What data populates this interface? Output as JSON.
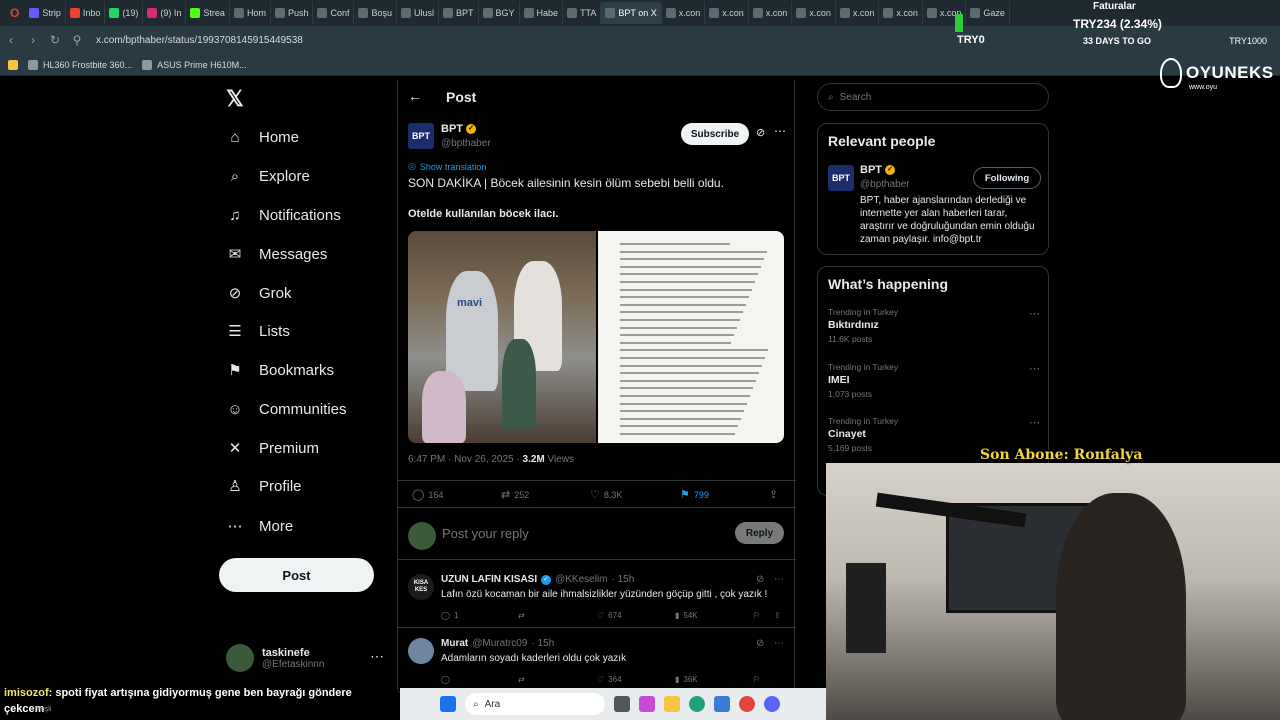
{
  "browser": {
    "tabs": [
      "Strip",
      "Inbo",
      "(19)",
      "(9) In",
      "Strea",
      "Hom",
      "Push",
      "Conf",
      "Boşu",
      "Ulusl",
      "BPT",
      "BGY",
      "Habe",
      "TTA",
      "BPT on X",
      "x.con",
      "x.con",
      "x.con",
      "x.con",
      "x.con",
      "x.con",
      "x.con",
      "Gaze"
    ],
    "url": "x.com/bpthaber/status/1993708145915449538",
    "bookmarks": [
      "HL360 Frostbite 360...",
      "ASUS Prime H610M..."
    ]
  },
  "overlay": {
    "faturalar": "Faturalar",
    "ticker_value": "TRY234 (2.34%)",
    "ticker_currency": "TRY0",
    "days_to_go": "33 DAYS TO GO",
    "ticker_right": "TRY1000",
    "brand_name": "OYUNEKS",
    "brand_sub": "www.oyu",
    "last_sub": "Son Abone: Ronfalya",
    "chat_user": "imisozof",
    "chat_msg": ": spoti fiyat artışına gidiyormuş gene ben bayrağı göndere",
    "chat_msg2": "çekcem",
    "chat_meta": "meşli"
  },
  "nav": {
    "items": [
      {
        "label": "Home",
        "icon": "home-icon"
      },
      {
        "label": "Explore",
        "icon": "search-icon"
      },
      {
        "label": "Notifications",
        "icon": "bell-icon"
      },
      {
        "label": "Messages",
        "icon": "envelope-icon"
      },
      {
        "label": "Grok",
        "icon": "grok-icon"
      },
      {
        "label": "Lists",
        "icon": "list-icon"
      },
      {
        "label": "Bookmarks",
        "icon": "bookmark-icon"
      },
      {
        "label": "Communities",
        "icon": "people-icon"
      },
      {
        "label": "Premium",
        "icon": "x-logo-icon"
      },
      {
        "label": "Profile",
        "icon": "person-icon"
      },
      {
        "label": "More",
        "icon": "more-circle-icon"
      }
    ],
    "post_label": "Post",
    "account_name": "taskinefe",
    "account_handle": "@Efetaskinnn"
  },
  "post": {
    "header": "Post",
    "author_name": "BPT",
    "author_handle": "@bpthaber",
    "logo_text": "BPT",
    "subscribe_label": "Subscribe",
    "show_translation": "Show translation",
    "text_line1": "SON DAKİKA | Böcek ailesinin kesin ölüm sebebi belli oldu.",
    "text_line2": "Otelde kullanılan böcek ilacı.",
    "photo_text": "mavi",
    "time": "6:47 PM · Nov 26, 2025 · ",
    "views": "3.2M",
    "views_label": " Views",
    "stats": {
      "replies": "164",
      "reposts": "252",
      "likes": "8.3K",
      "bookmarks": "799"
    },
    "reply_placeholder": "Post your reply",
    "reply_label": "Reply"
  },
  "replies": [
    {
      "name": "UZUN LAFIN KISASI",
      "handle": "@KKeselim",
      "time": "· 15h",
      "text": "Lafın özü kocaman bir aile ihmalsizlikler yüzünden göçüp gitti , çok yazık !",
      "replies": "1",
      "reposts": "",
      "likes": "674",
      "views": "54K",
      "avatar_text": "KISA KES"
    },
    {
      "name": "Murat",
      "handle": "@Muratrc09",
      "time": "· 15h",
      "text": "Adamların soyadı kaderleri oldu çok yazık",
      "replies": "",
      "reposts": "",
      "likes": "364",
      "views": "36K",
      "avatar_text": ""
    }
  ],
  "sidebar": {
    "search_placeholder": "Search",
    "relevant_title": "Relevant people",
    "person_name": "BPT",
    "person_handle": "@bpthaber",
    "person_logo": "BPT",
    "following_label": "Following",
    "person_bio": "BPT, haber ajanslarından derlediği ve internette yer alan haberleri tarar, araştırır ve doğruluğundan emin olduğu zaman paylaşır. info@bpt.tr",
    "happening_title": "What’s happening",
    "trends": [
      {
        "context": "Trending in Turkey",
        "topic": "Bıktırdınız",
        "count": "11.6K posts"
      },
      {
        "context": "Trending in Turkey",
        "topic": "IMEI",
        "count": "1,073 posts"
      },
      {
        "context": "Trending in Turkey",
        "topic": "Cinayet",
        "count": "5,169 posts"
      }
    ]
  },
  "taskbar": {
    "search_label": "Ara"
  }
}
